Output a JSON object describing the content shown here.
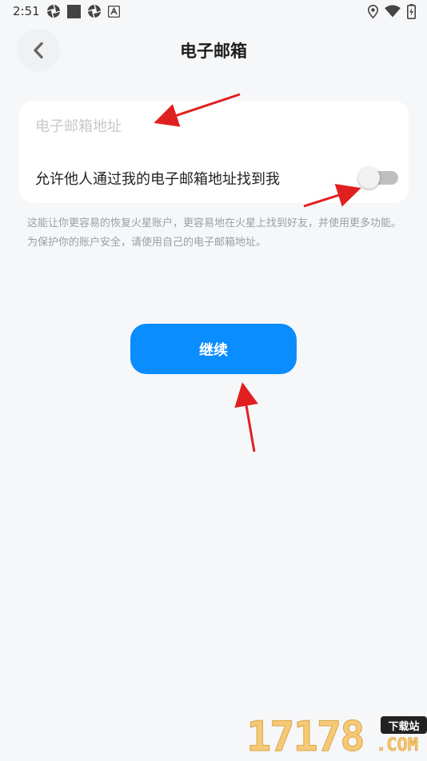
{
  "status_bar": {
    "time": "2:51",
    "icons_left": [
      "aperture-icon",
      "square-icon",
      "aperture-icon",
      "a-box-icon"
    ],
    "icons_right": [
      "location-icon",
      "wifi-icon",
      "battery-charging-icon"
    ]
  },
  "header": {
    "title": "电子邮箱",
    "back_icon": "chevron-left-icon"
  },
  "form": {
    "email_placeholder": "电子邮箱地址",
    "email_value": "",
    "toggle_label": "允许他人通过我的电子邮箱地址找到我",
    "toggle_on": false
  },
  "hint_text": "这能让你更容易的恢复火星账户，更容易地在火星上找到好友，并使用更多功能。为保护你的账户安全，请使用自己的电子邮箱地址。",
  "continue_label": "继续",
  "watermark": {
    "number": "17178",
    "badge": "下载站",
    "domain": ".COM"
  },
  "colors": {
    "background": "#f6f7f9",
    "primary": "#0a8dff",
    "annotation_arrow": "#e02020"
  }
}
